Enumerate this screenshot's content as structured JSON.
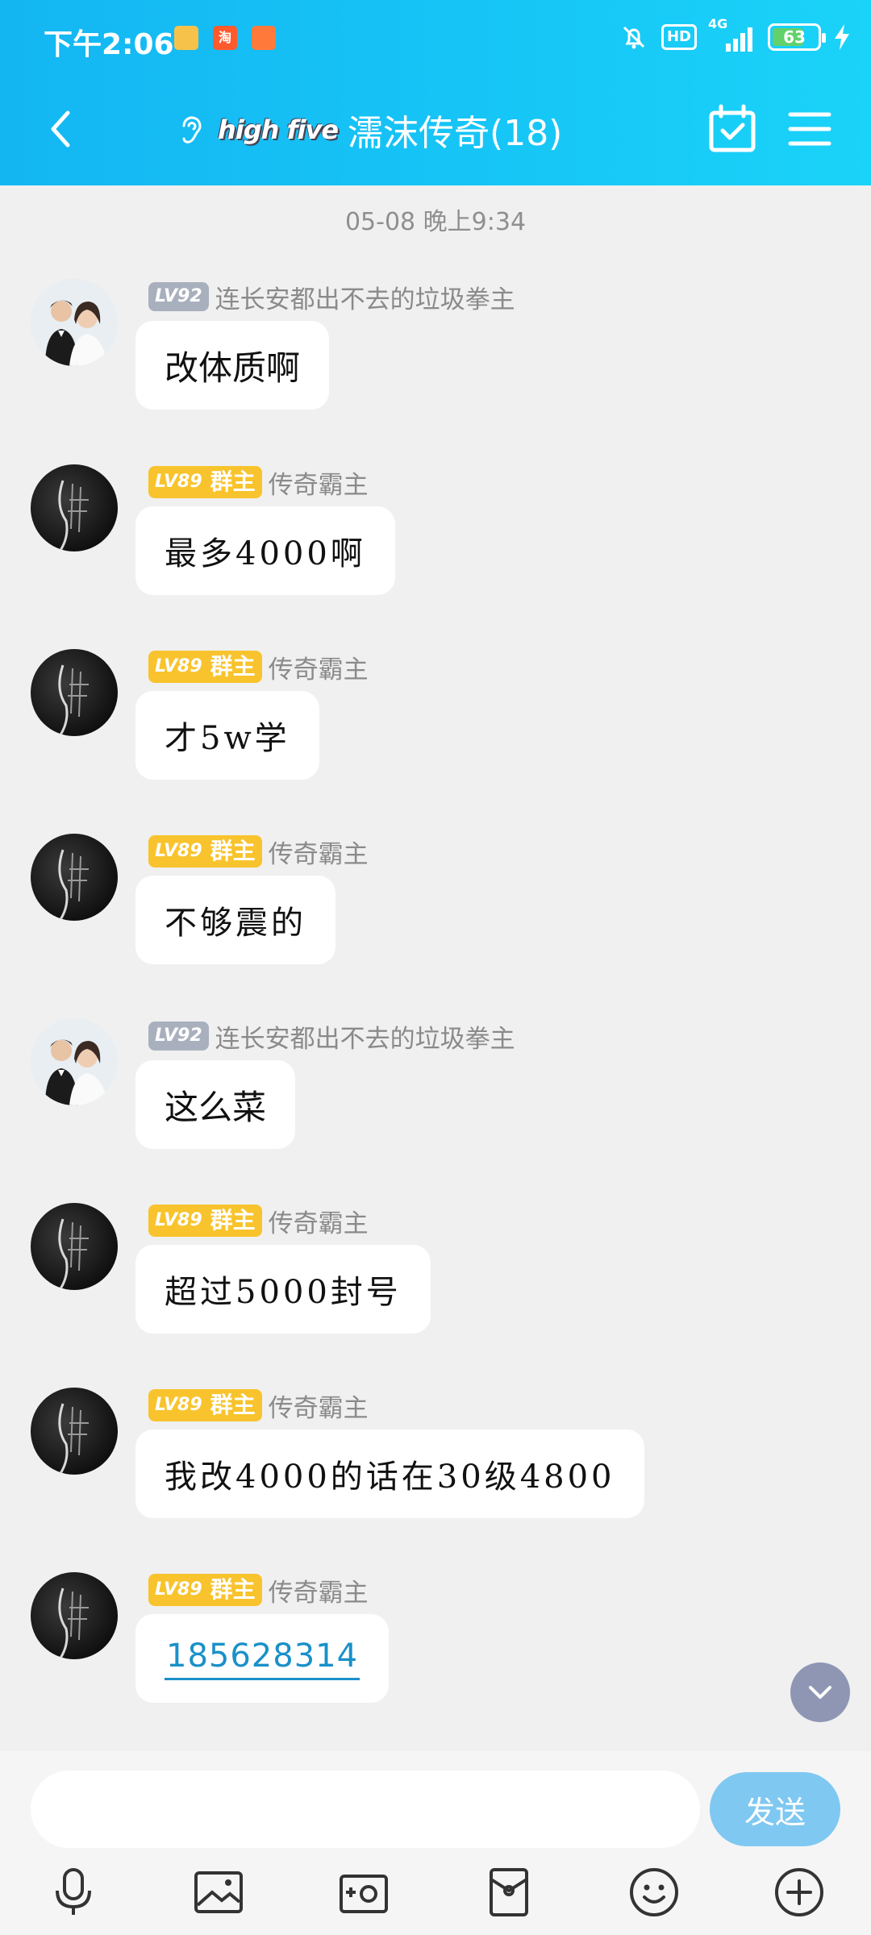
{
  "status_bar": {
    "time": "下午2:06",
    "taobao_label": "淘",
    "hd_label": "HD",
    "network_label": "4G",
    "battery": "63"
  },
  "header": {
    "brand": "high five",
    "title": "濡沫传奇(18)"
  },
  "chat": {
    "date_separator": "05-08 晚上9:34",
    "owner_badge_text": "群主",
    "messages": [
      {
        "level": "LV92",
        "owner": false,
        "sender": "连长安都出不去的垃圾拳主",
        "text": "改体质啊",
        "avatar": "couple-avatar"
      },
      {
        "level": "LV89",
        "owner": true,
        "sender": "传奇霸主",
        "text": "最多4000啊",
        "avatar": "dark-avatar"
      },
      {
        "level": "LV89",
        "owner": true,
        "sender": "传奇霸主",
        "text": "才5w学",
        "avatar": "dark-avatar"
      },
      {
        "level": "LV89",
        "owner": true,
        "sender": "传奇霸主",
        "text": "不够震的",
        "avatar": "dark-avatar"
      },
      {
        "level": "LV92",
        "owner": false,
        "sender": "连长安都出不去的垃圾拳主",
        "text": "这么菜",
        "avatar": "couple-avatar"
      },
      {
        "level": "LV89",
        "owner": true,
        "sender": "传奇霸主",
        "text": "超过5000封号",
        "avatar": "dark-avatar"
      },
      {
        "level": "LV89",
        "owner": true,
        "sender": "传奇霸主",
        "text": "我改4000的话在30级4800",
        "avatar": "dark-avatar"
      },
      {
        "level": "LV89",
        "owner": true,
        "sender": "传奇霸主",
        "text": "185628314",
        "avatar": "dark-avatar"
      }
    ]
  },
  "input": {
    "placeholder": "",
    "send_label": "发送"
  },
  "toolbar": {
    "icons": [
      "microphone-icon",
      "photo-icon",
      "camera-icon",
      "red-packet-icon",
      "emoji-icon",
      "plus-icon"
    ]
  },
  "colors": {
    "header_start": "#14b6f2",
    "header_end": "#1ad3f8",
    "owner_badge": "#f8c32c",
    "level_badge": "#a9b0bd",
    "send_button": "#7fc8f1",
    "link": "#1a90c8"
  }
}
